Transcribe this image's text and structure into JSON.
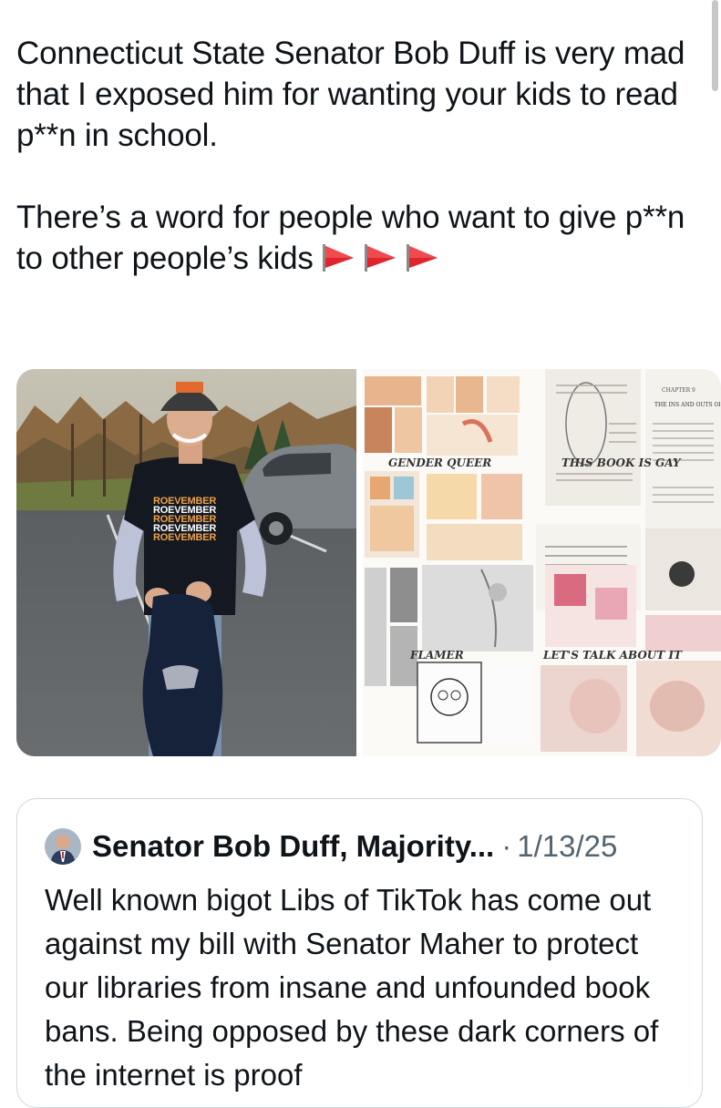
{
  "tweet": {
    "paragraph1": "Connecticut State Senator Bob Duff is very mad that I exposed him for wanting your kids to read p**n in school.",
    "paragraph2": "There’s a word for people who want to give p**n to other people’s kids",
    "flag_icons": [
      "triangular-flag-icon",
      "triangular-flag-icon",
      "triangular-flag-icon"
    ]
  },
  "media": {
    "shirt_text": [
      "ROEVEMBER",
      "ROEVEMBER",
      "ROEVEMBER",
      "ROEVEMBER",
      "ROEVEMBER"
    ],
    "collage_titles": {
      "gender_queer": "GENDER QUEER",
      "this_book_is_gay": "THIS BOOK IS GAY",
      "flamer": "FLAMER",
      "lets_talk": "LET'S TALK ABOUT IT"
    },
    "chapter_heading": "THE INS AND OUTS OF GAY",
    "chapter_label": "CHAPTER 9"
  },
  "quote": {
    "author": "Senator Bob Duff, Majority...",
    "separator": "·",
    "date": "1/13/25",
    "text": "Well known bigot Libs of TikTok has come out against my bill with Senator Maher to protect our libraries from insane and unfounded book bans. Being opposed by these dark corners of the internet is proof"
  },
  "colors": {
    "text": "#0f1419",
    "muted": "#536471",
    "border": "#cfd9de",
    "flag": "#e0242e"
  }
}
